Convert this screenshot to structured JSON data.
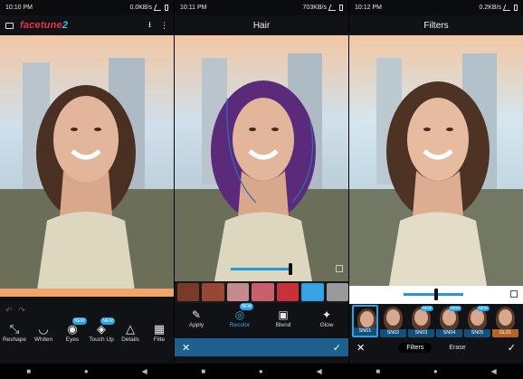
{
  "panels": [
    {
      "status": {
        "time": "10:10 PM",
        "net": "0.0KB/s"
      },
      "app_logo_main": "facetune",
      "app_logo_num": "2",
      "undo": "↶",
      "redo": "↷",
      "tools": [
        {
          "label": "Reshape",
          "icon": "reshape-icon",
          "glyph": "⤡",
          "badge": ""
        },
        {
          "label": "Whiten",
          "icon": "lips-icon",
          "glyph": "◡",
          "badge": ""
        },
        {
          "label": "Eyes",
          "icon": "eye-icon",
          "glyph": "◉",
          "badge": "NEW"
        },
        {
          "label": "Touch Up",
          "icon": "drop-icon",
          "glyph": "◈",
          "badge": "NEW"
        },
        {
          "label": "Details",
          "icon": "triangle-icon",
          "glyph": "△",
          "badge": ""
        },
        {
          "label": "Filte",
          "icon": "filter-icon",
          "glyph": "▦",
          "badge": ""
        }
      ]
    },
    {
      "status": {
        "time": "10:11 PM",
        "net": "703KB/s"
      },
      "title": "Hair",
      "swatch_colors": [
        "#7a3a2a",
        "#9b4535",
        "#c68a8a",
        "#c95f6a",
        "#c8303a",
        "#3aa3e6",
        "#9a9a9a"
      ],
      "tools": [
        {
          "label": "Apply",
          "icon": "brush-icon",
          "glyph": "✎"
        },
        {
          "label": "Recolor",
          "icon": "recolor-icon",
          "glyph": "◎",
          "badge": "NEW"
        },
        {
          "label": "Blend",
          "icon": "blend-icon",
          "glyph": "▣"
        },
        {
          "label": "Glow",
          "icon": "sparkle-icon",
          "glyph": "✦"
        }
      ],
      "cancel": "✕",
      "confirm": "✓"
    },
    {
      "status": {
        "time": "10:12 PM",
        "net": "0.2KB/s"
      },
      "title": "Filters",
      "filters": [
        "SN01",
        "SN02",
        "SN03",
        "SN04",
        "SN05",
        "GL01"
      ],
      "filter_badge": "NEW",
      "mode_filters": "Filters",
      "mode_erase": "Erase",
      "cancel": "✕",
      "confirm": "✓"
    }
  ],
  "nav": {
    "home": "●",
    "back": "◀",
    "recents": "■"
  },
  "colors": {
    "accent": "#2aa3e6",
    "action_bar": "#1d5f8e",
    "brand": "#e8324a"
  }
}
